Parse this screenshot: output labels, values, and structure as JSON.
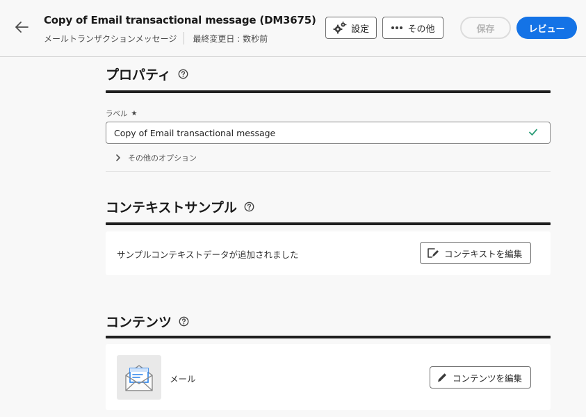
{
  "header": {
    "title": "Copy of Email transactional message (DM3675)",
    "subtitle": "メールトランザクションメッセージ",
    "last_modified": "最終変更日 : 数秒前",
    "settings_label": "設定",
    "more_label": "その他",
    "save_label": "保存",
    "review_label": "レビュー"
  },
  "properties": {
    "title": "プロパティ",
    "label_field_label": "ラベル",
    "required_mark": "★",
    "label_value": "Copy of Email transactional message",
    "more_options": "その他のオプション"
  },
  "context_sample": {
    "title": "コンテキストサンプル",
    "status_text": "サンプルコンテキストデータが追加されました",
    "edit_button": "コンテキストを編集"
  },
  "contents": {
    "title": "コンテンツ",
    "channel_label": "メール",
    "edit_button": "コンテンツを編集"
  },
  "colors": {
    "accent": "#1473e6",
    "success": "#2d9d78",
    "icon_blue": "#2680eb"
  }
}
